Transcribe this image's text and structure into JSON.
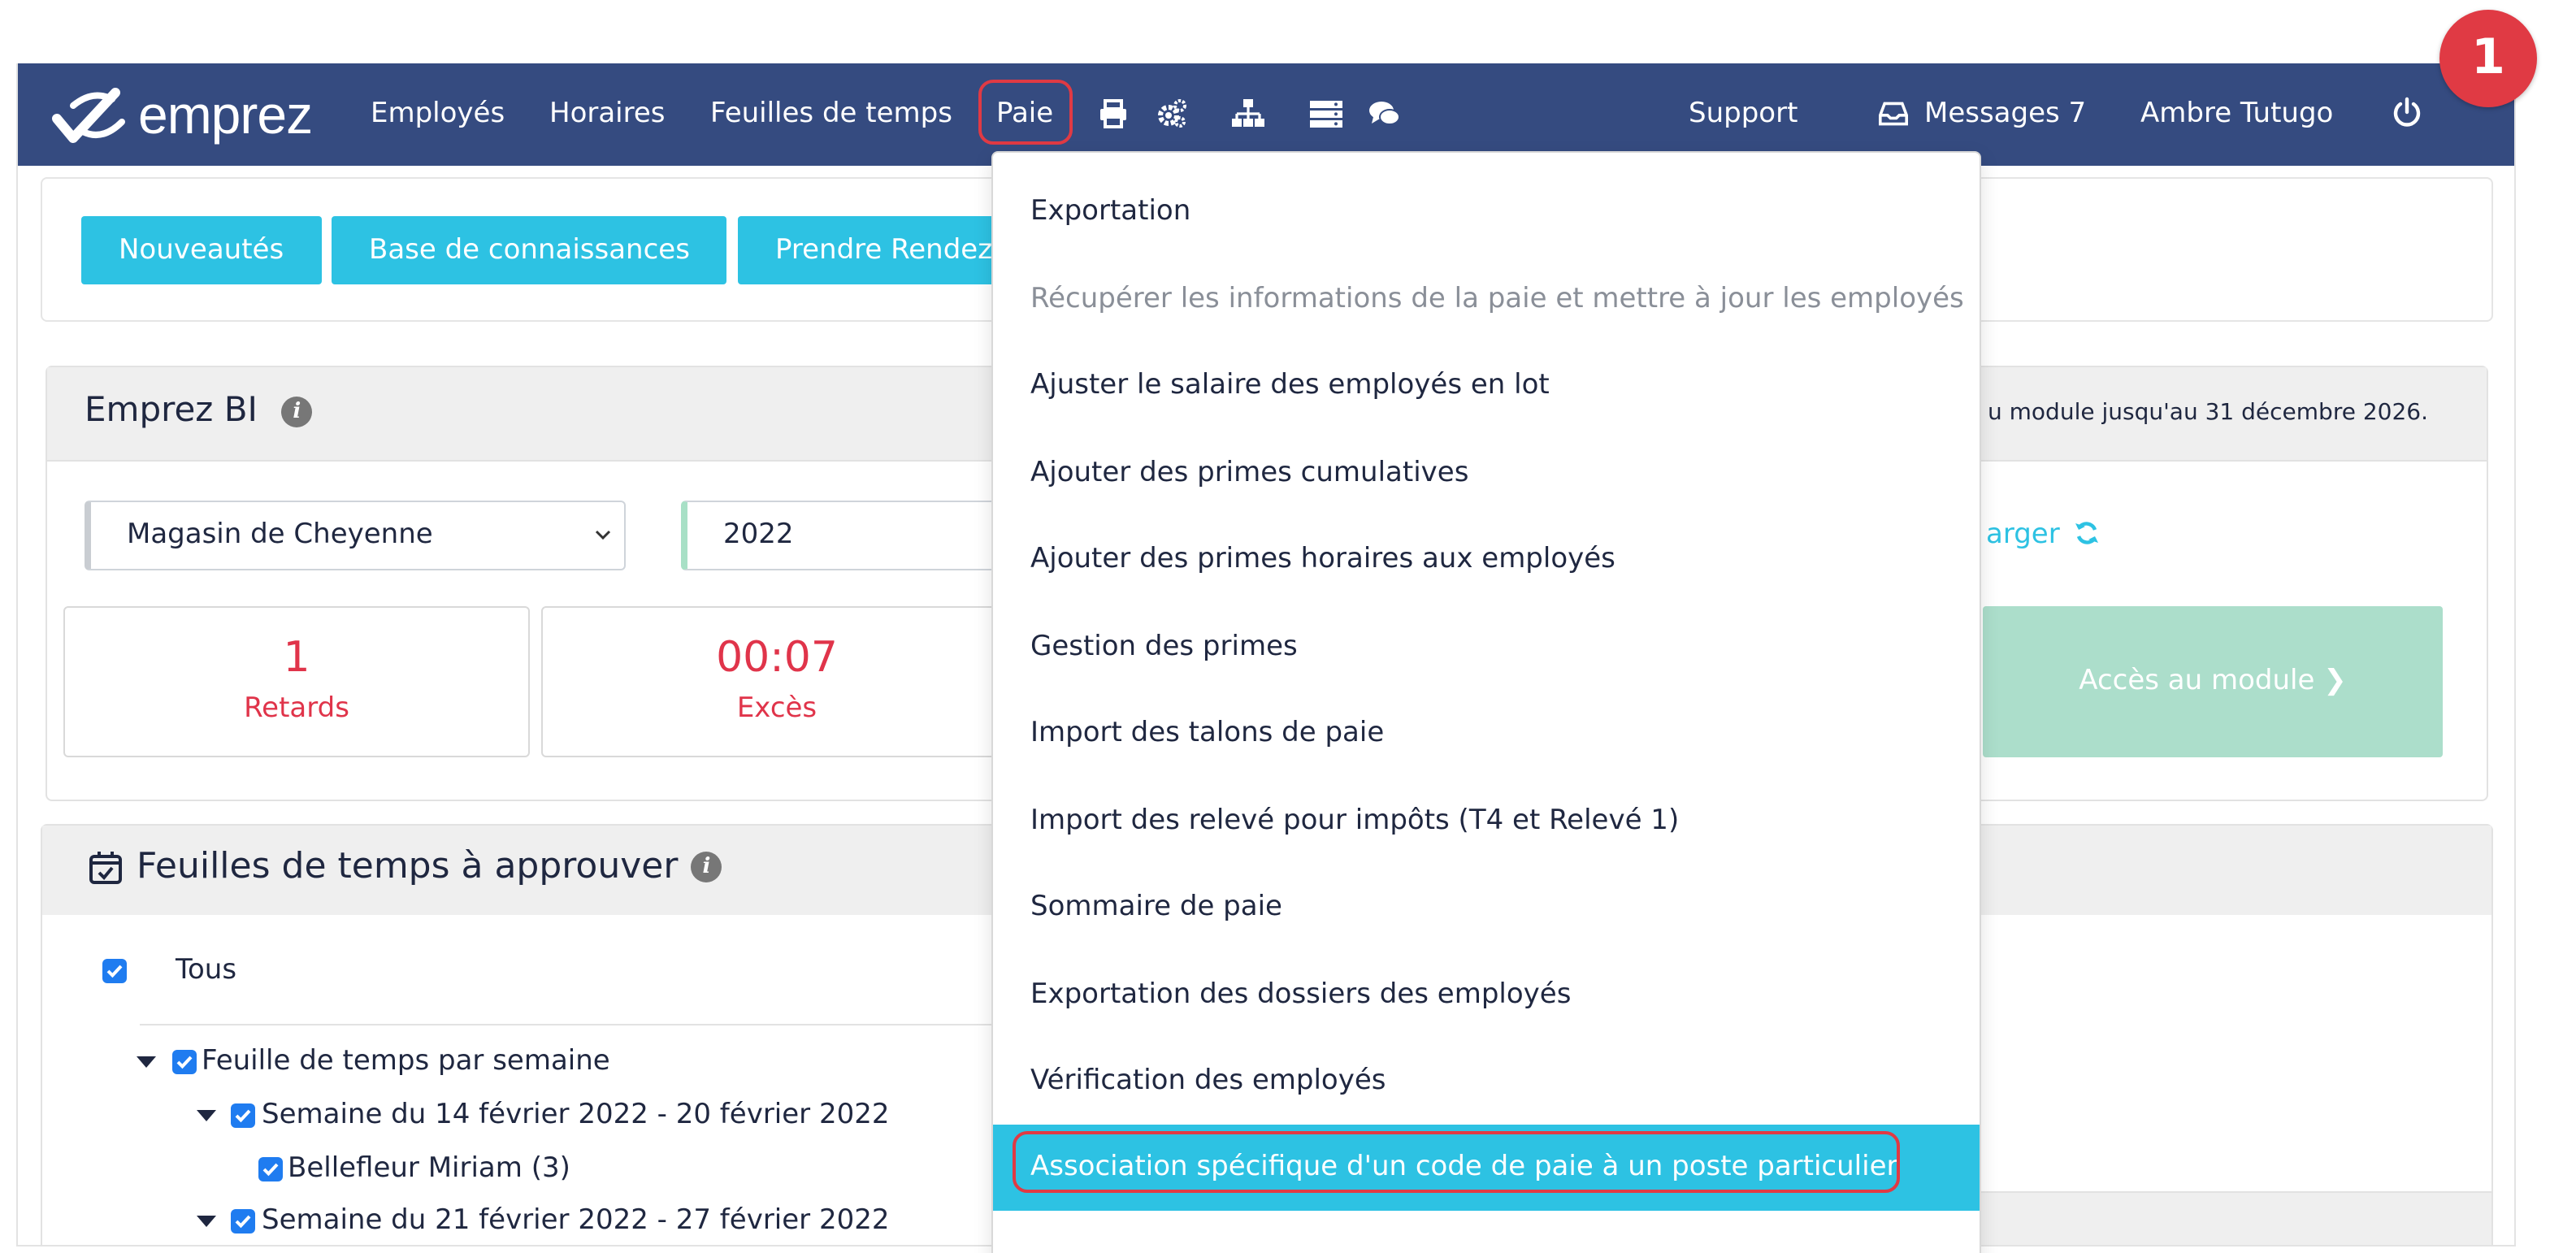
{
  "badge": "1",
  "navbar": {
    "logo_text": "emprez",
    "links": [
      "Employés",
      "Horaires",
      "Feuilles de temps",
      "Paie"
    ],
    "icons": [
      "print-icon",
      "gears-icon",
      "sitemap-icon",
      "server-icon",
      "comments-icon"
    ],
    "support": "Support",
    "messages": "Messages 7",
    "user": "Ambre Tutugo"
  },
  "toolbar": {
    "buttons": [
      "Nouveautés",
      "Base de connaissances",
      "Prendre Rendez"
    ]
  },
  "bi": {
    "title": "Emprez BI",
    "module_note": "u module jusqu'au 31 décembre 2026.",
    "store_select": "Magasin de Cheyenne",
    "year_select": "2022",
    "reload": "arger",
    "stats": [
      {
        "value": "1",
        "label": "Retards"
      },
      {
        "value": "00:07",
        "label": "Excès"
      }
    ],
    "module_button": "Accès au module"
  },
  "timesheets": {
    "title": "Feuilles de temps à approuver",
    "all_label": "Tous",
    "group_label": "Feuille de temps par semaine",
    "week1": "Semaine du 14 février 2022 - 20 février 2022",
    "employee": "Bellefleur Miriam (3)",
    "week2": "Semaine du 21 février 2022 - 27 février 2022"
  },
  "dropdown": {
    "items": [
      {
        "label": "Exportation",
        "state": "normal"
      },
      {
        "label": "Récupérer les informations de la paie et mettre à jour les employés",
        "state": "disabled"
      },
      {
        "label": "Ajuster le salaire des employés en lot",
        "state": "normal"
      },
      {
        "label": "Ajouter des primes cumulatives",
        "state": "normal"
      },
      {
        "label": "Ajouter des primes horaires aux employés",
        "state": "normal"
      },
      {
        "label": "Gestion des primes",
        "state": "normal"
      },
      {
        "label": "Import des talons de paie",
        "state": "normal"
      },
      {
        "label": "Import des relevé pour impôts (T4 et Relevé 1)",
        "state": "normal"
      },
      {
        "label": "Sommaire de paie",
        "state": "normal"
      },
      {
        "label": "Exportation des dossiers des employés",
        "state": "normal"
      },
      {
        "label": "Vérification des employés",
        "state": "normal"
      },
      {
        "label": "Association spécifique d'un code de paie à un poste particulier",
        "state": "active"
      }
    ]
  },
  "colors": {
    "navbar": "#354b80",
    "accent": "#2dc2e3",
    "highlight": "#e03a44",
    "stat_red": "#e0344a",
    "module_green": "#acdecb"
  }
}
